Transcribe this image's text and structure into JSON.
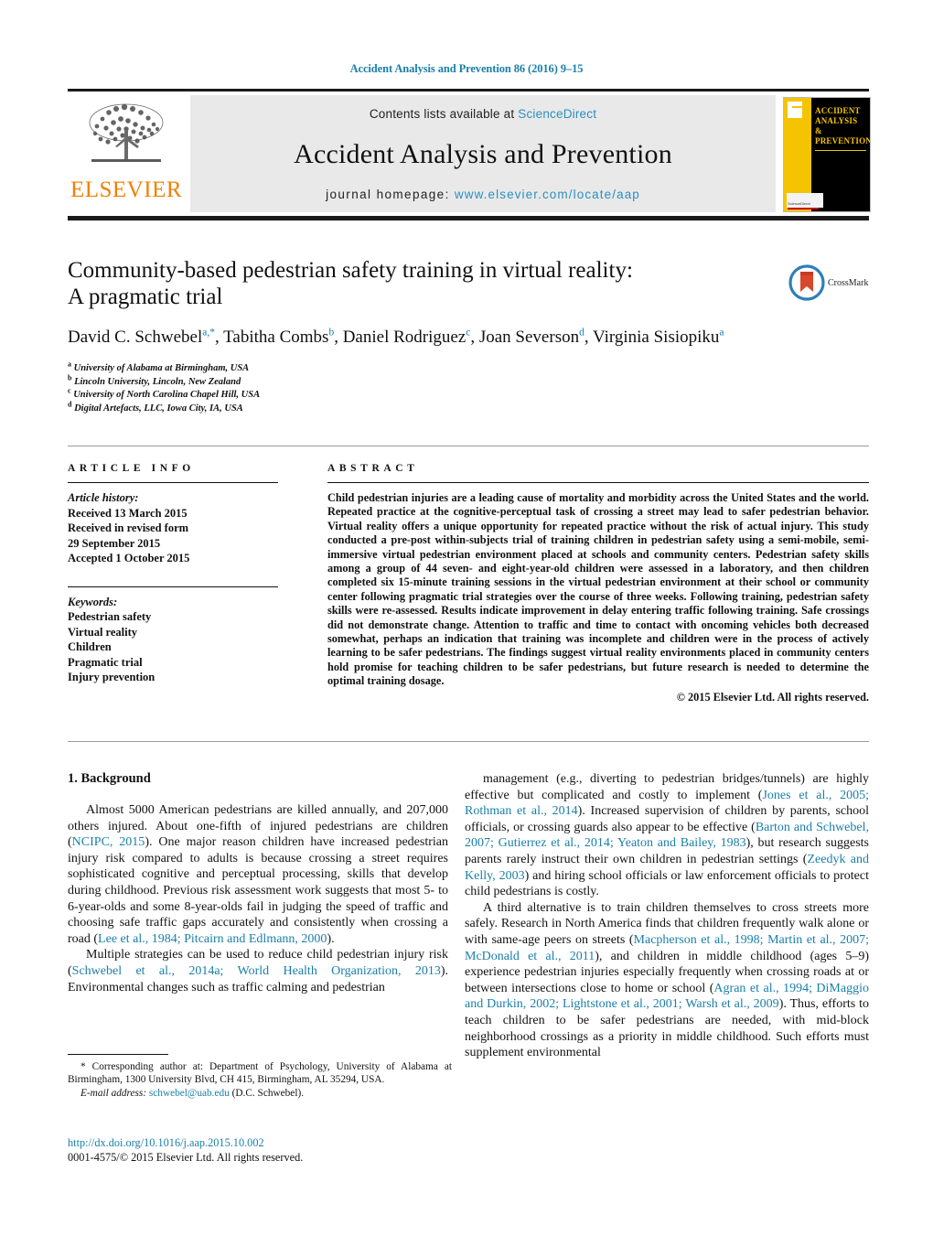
{
  "running_head": "Accident Analysis and Prevention 86 (2016) 9–15",
  "masthead": {
    "publisher_logo_text": "ELSEVIER",
    "contents_prefix": "Contents lists available at ",
    "contents_link": "ScienceDirect",
    "journal_name": "Accident Analysis and Prevention",
    "homepage_prefix": "journal homepage: ",
    "homepage_url": "www.elsevier.com/locate/aap",
    "cover": {
      "line1": "ACCIDENT",
      "line2": "ANALYSIS",
      "line3": "&",
      "line4": "PREVENTION",
      "footer": "ScienceDirect"
    }
  },
  "crossmark": {
    "label": "CrossMark"
  },
  "article": {
    "title_line1": "Community-based pedestrian safety training in virtual reality:",
    "title_line2": "A pragmatic trial",
    "authors": [
      {
        "name": "David C. Schwebel",
        "marks": "a,*",
        "sep": ", "
      },
      {
        "name": "Tabitha Combs",
        "marks": "b",
        "sep": ", "
      },
      {
        "name": "Daniel Rodriguez",
        "marks": "c",
        "sep": ", "
      },
      {
        "name": "Joan Severson",
        "marks": "d",
        "sep": ", "
      },
      {
        "name": "Virginia Sisiopiku",
        "marks": "a",
        "sep": ""
      }
    ],
    "affiliations": [
      {
        "mark": "a",
        "text": "University of Alabama at Birmingham, USA"
      },
      {
        "mark": "b",
        "text": "Lincoln University, Lincoln, New Zealand"
      },
      {
        "mark": "c",
        "text": "University of North Carolina Chapel Hill, USA"
      },
      {
        "mark": "d",
        "text": "Digital Artefacts, LLC, Iowa City, IA, USA"
      }
    ]
  },
  "article_info": {
    "heading": "ARTICLE INFO",
    "history_label": "Article history:",
    "history_lines": [
      "Received 13 March 2015",
      "Received in revised form",
      "29 September 2015",
      "Accepted 1 October 2015"
    ],
    "keywords_label": "Keywords:",
    "keywords": [
      "Pedestrian safety",
      "Virtual reality",
      "Children",
      "Pragmatic trial",
      "Injury prevention"
    ]
  },
  "abstract": {
    "heading": "ABSTRACT",
    "text": "Child pedestrian injuries are a leading cause of mortality and morbidity across the United States and the world. Repeated practice at the cognitive-perceptual task of crossing a street may lead to safer pedestrian behavior. Virtual reality offers a unique opportunity for repeated practice without the risk of actual injury. This study conducted a pre-post within-subjects trial of training children in pedestrian safety using a semi-mobile, semi-immersive virtual pedestrian environment placed at schools and community centers. Pedestrian safety skills among a group of 44 seven- and eight-year-old children were assessed in a laboratory, and then children completed six 15-minute training sessions in the virtual pedestrian environment at their school or community center following pragmatic trial strategies over the course of three weeks. Following training, pedestrian safety skills were re-assessed. Results indicate improvement in delay entering traffic following training. Safe crossings did not demonstrate change. Attention to traffic and time to contact with oncoming vehicles both decreased somewhat, perhaps an indication that training was incomplete and children were in the process of actively learning to be safer pedestrians. The findings suggest virtual reality environments placed in community centers hold promise for teaching children to be safer pedestrians, but future research is needed to determine the optimal training dosage.",
    "copyright": "© 2015 Elsevier Ltd. All rights reserved."
  },
  "body": {
    "section_number_title": "1. Background",
    "left_paragraphs": [
      {
        "runs": [
          {
            "t": "Almost 5000 American pedestrians are killed annually, and 207,000 others injured. About one-fifth of injured pedestrians are children (",
            "cite": false
          },
          {
            "t": "NCIPC, 2015",
            "cite": true
          },
          {
            "t": "). One major reason children have increased pedestrian injury risk compared to adults is because crossing a street requires sophisticated cognitive and perceptual processing, skills that develop during childhood. Previous risk assessment work suggests that most 5- to 6-year-olds and some 8-year-olds fail in judging the speed of traffic and choosing safe traffic gaps accurately and consistently when crossing a road (",
            "cite": false
          },
          {
            "t": "Lee et al., 1984; Pitcairn and Edlmann, 2000",
            "cite": true
          },
          {
            "t": ").",
            "cite": false
          }
        ]
      },
      {
        "runs": [
          {
            "t": "Multiple strategies can be used to reduce child pedestrian injury risk (",
            "cite": false
          },
          {
            "t": "Schwebel et al., 2014a; World Health Organization, 2013",
            "cite": true
          },
          {
            "t": "). Environmental changes such as traffic calming and pedestrian",
            "cite": false
          }
        ]
      }
    ],
    "right_paragraphs": [
      {
        "runs": [
          {
            "t": "management (e.g., diverting to pedestrian bridges/tunnels) are highly effective but complicated and costly to implement (",
            "cite": false
          },
          {
            "t": "Jones et al., 2005; Rothman et al., 2014",
            "cite": true
          },
          {
            "t": "). Increased supervision of children by parents, school officials, or crossing guards also appear to be effective (",
            "cite": false
          },
          {
            "t": "Barton and Schwebel, 2007; Gutierrez et al., 2014; Yeaton and Bailey, 1983",
            "cite": true
          },
          {
            "t": "), but research suggests parents rarely instruct their own children in pedestrian settings (",
            "cite": false
          },
          {
            "t": "Zeedyk and Kelly, 2003",
            "cite": true
          },
          {
            "t": ") and hiring school officials or law enforcement officials to protect child pedestrians is costly.",
            "cite": false
          }
        ]
      },
      {
        "runs": [
          {
            "t": "A third alternative is to train children themselves to cross streets more safely. Research in North America finds that children frequently walk alone or with same-age peers on streets (",
            "cite": false
          },
          {
            "t": "Macpherson et al., 1998; Martin et al., 2007; McDonald et al., 2011",
            "cite": true
          },
          {
            "t": "), and children in middle childhood (ages 5–9) experience pedestrian injuries especially frequently when crossing roads at or between intersections close to home or school (",
            "cite": false
          },
          {
            "t": "Agran et al., 1994; DiMaggio and Durkin, 2002; Lightstone et al., 2001; Warsh et al., 2009",
            "cite": true
          },
          {
            "t": "). Thus, efforts to teach children to be safer pedestrians are needed, with mid-block neighborhood crossings as a priority in middle childhood. Such efforts must supplement environmental",
            "cite": false
          }
        ]
      }
    ]
  },
  "footnotes": {
    "corresponding_marker": "*",
    "corresponding_text": " Corresponding author at: Department of Psychology, University of Alabama at Birmingham, 1300 University Blvd, CH 415, Birmingham, AL 35294, USA.",
    "email_label": "E-mail address:",
    "email": "schwebel@uab.edu",
    "email_attrib": " (D.C. Schwebel)."
  },
  "doi_block": {
    "doi_url": "http://dx.doi.org/10.1016/j.aap.2015.10.002",
    "issn_line": "0001-4575/© 2015 Elsevier Ltd. All rights reserved."
  },
  "colors": {
    "link_blue": "#1a7fa8",
    "sciencedirect_blue": "#2c8fc0",
    "elsevier_orange": "#f08000",
    "cover_yellow": "#f5c400",
    "band_gray": "#e9e9e9"
  }
}
